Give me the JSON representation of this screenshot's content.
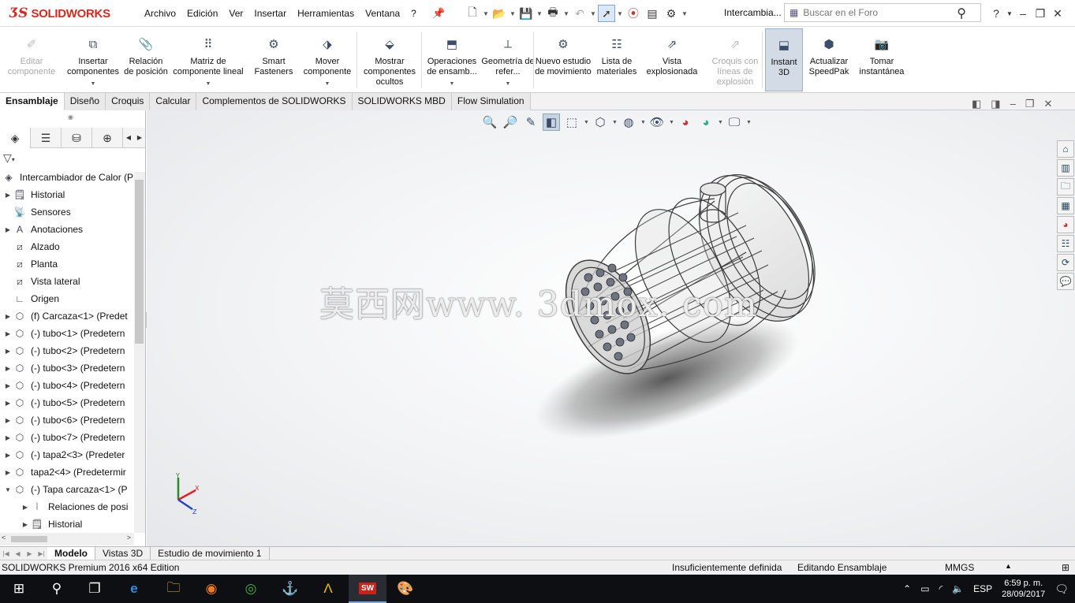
{
  "app": {
    "brand_ds": "3S",
    "brand_name": "SOLIDWORKS"
  },
  "menu": [
    "Archivo",
    "Edición",
    "Ver",
    "Insertar",
    "Herramientas",
    "Ventana",
    "?"
  ],
  "document_title": "Intercambia...",
  "search": {
    "placeholder": "Buscar en el Foro"
  },
  "ribbon": [
    {
      "label": "Editar componente",
      "icon": "edit-component-icon",
      "disabled": true
    },
    {
      "label": "Insertar componentes",
      "icon": "insert-components-icon"
    },
    {
      "label": "Relación de posición",
      "icon": "mate-icon"
    },
    {
      "label": "Matriz de componente lineal",
      "icon": "linear-pattern-icon"
    },
    {
      "label": "Smart Fasteners",
      "icon": "smart-fasteners-icon"
    },
    {
      "label": "Mover componente",
      "icon": "move-component-icon"
    },
    {
      "label": "Mostrar componentes ocultos",
      "icon": "show-hidden-icon"
    },
    {
      "label": "Operaciones de ensamb...",
      "icon": "assembly-features-icon"
    },
    {
      "label": "Geometría de refer...",
      "icon": "reference-geometry-icon"
    },
    {
      "label": "Nuevo estudio de movimiento",
      "icon": "motion-study-icon"
    },
    {
      "label": "Lista de materiales",
      "icon": "bom-icon"
    },
    {
      "label": "Vista explosionada",
      "icon": "exploded-view-icon"
    },
    {
      "label": "Croquis con líneas de explosión",
      "icon": "explode-line-sketch-icon",
      "disabled": true
    },
    {
      "label": "Instant 3D",
      "icon": "instant3d-icon",
      "active": true
    },
    {
      "label": "Actualizar SpeedPak",
      "icon": "speedpak-icon"
    },
    {
      "label": "Tomar instantánea",
      "icon": "snapshot-icon"
    }
  ],
  "command_tabs": [
    "Ensamblaje",
    "Diseño",
    "Croquis",
    "Calcular",
    "Complementos de SOLIDWORKS",
    "SOLIDWORKS MBD",
    "Flow Simulation"
  ],
  "tree": {
    "root": "Intercambiador de Calor  (P",
    "items": [
      {
        "label": "Historial",
        "icon": "history-icon",
        "expand": true,
        "indent": 0
      },
      {
        "label": "Sensores",
        "icon": "sensors-icon",
        "expand": false,
        "indent": 0
      },
      {
        "label": "Anotaciones",
        "icon": "annotations-icon",
        "expand": true,
        "indent": 0
      },
      {
        "label": "Alzado",
        "icon": "plane-icon",
        "expand": false,
        "indent": 0
      },
      {
        "label": "Planta",
        "icon": "plane-icon",
        "expand": false,
        "indent": 0
      },
      {
        "label": "Vista lateral",
        "icon": "plane-icon",
        "expand": false,
        "indent": 0
      },
      {
        "label": "Origen",
        "icon": "origin-icon",
        "expand": false,
        "indent": 0
      },
      {
        "label": "(f) Carcaza<1> (Predet",
        "icon": "part-icon",
        "expand": true,
        "indent": 0
      },
      {
        "label": "(-) tubo<1> (Predetern",
        "icon": "part-icon",
        "expand": true,
        "indent": 0
      },
      {
        "label": "(-) tubo<2> (Predetern",
        "icon": "part-icon",
        "expand": true,
        "indent": 0
      },
      {
        "label": "(-) tubo<3> (Predetern",
        "icon": "part-icon",
        "expand": true,
        "indent": 0
      },
      {
        "label": "(-) tubo<4> (Predetern",
        "icon": "part-icon",
        "expand": true,
        "indent": 0
      },
      {
        "label": "(-) tubo<5> (Predetern",
        "icon": "part-icon",
        "expand": true,
        "indent": 0
      },
      {
        "label": "(-) tubo<6> (Predetern",
        "icon": "part-icon",
        "expand": true,
        "indent": 0
      },
      {
        "label": "(-) tubo<7> (Predetern",
        "icon": "part-icon",
        "expand": true,
        "indent": 0
      },
      {
        "label": "(-) tapa2<3> (Predeter",
        "icon": "part-icon",
        "expand": true,
        "indent": 0
      },
      {
        "label": "tapa2<4> (Predetermir",
        "icon": "part-icon",
        "expand": true,
        "indent": 0
      },
      {
        "label": "(-) Tapa carcaza<1> (P",
        "icon": "part-icon",
        "expand": "open",
        "indent": 0
      },
      {
        "label": "Relaciones de posi",
        "icon": "mates-folder-icon",
        "expand": true,
        "indent": 1
      },
      {
        "label": "Historial",
        "icon": "history-icon",
        "expand": true,
        "indent": 1
      }
    ]
  },
  "watermark": "莫西网www. 3dmox. com",
  "bottom_tabs": [
    "Modelo",
    "Vistas 3D",
    "Estudio de movimiento 1"
  ],
  "status": {
    "edition": "SOLIDWORKS Premium 2016 x64 Edition",
    "definition": "Insuficientemente definida",
    "mode": "Editando Ensamblaje",
    "units": "MMGS"
  },
  "taskbar": {
    "lang": "ESP",
    "time": "6:59 p. m.",
    "date": "28/09/2017"
  }
}
